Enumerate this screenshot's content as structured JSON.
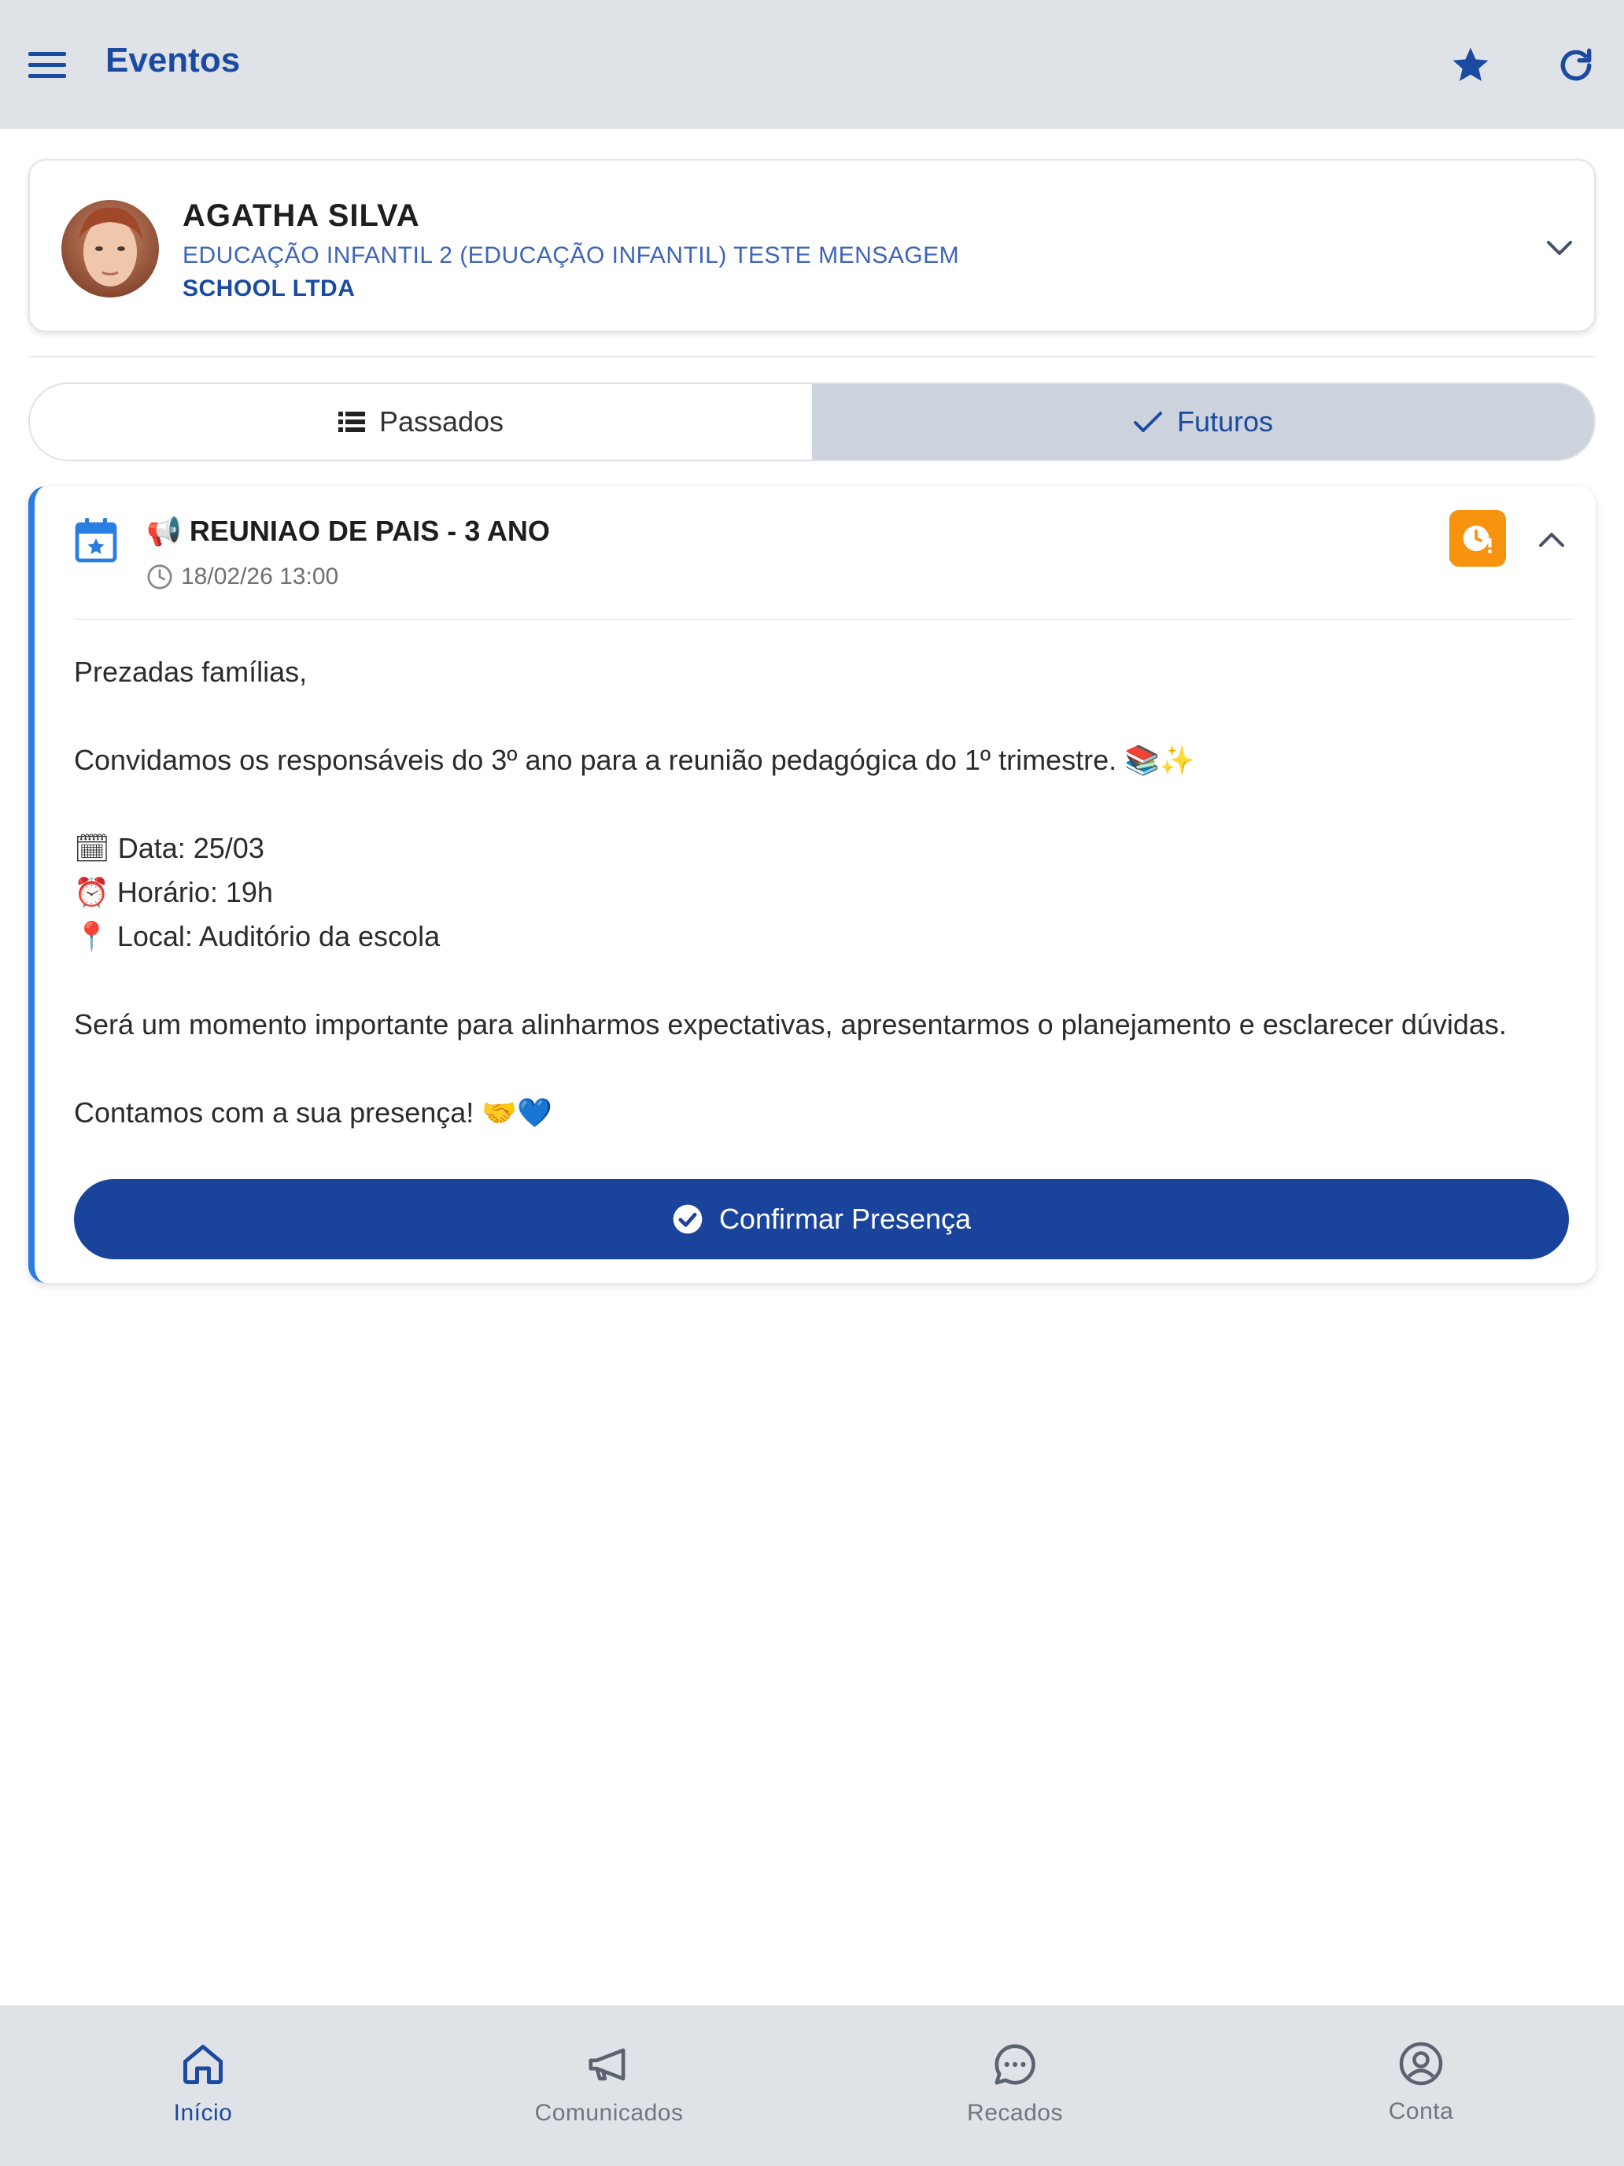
{
  "appbar": {
    "title": "Eventos",
    "menu_icon": "menu-icon",
    "favorite_icon": "star-icon",
    "refresh_icon": "refresh-icon"
  },
  "student": {
    "name": "AGATHA SILVA",
    "class": "EDUCAÇÃO INFANTIL 2 (EDUCAÇÃO INFANTIL) TESTE MENSAGEM",
    "school": "SCHOOL LTDA"
  },
  "tabs": [
    {
      "label": "Passados",
      "icon": "list-icon",
      "active": false
    },
    {
      "label": "Futuros",
      "icon": "check-icon",
      "active": true
    }
  ],
  "event": {
    "title": "📢 REUNIAO DE PAIS - 3 ANO",
    "datetime": "18/02/26 13:00",
    "body": {
      "greeting": "Prezadas famílias,",
      "invite": "Convidamos os responsáveis do 3º ano para a reunião pedagógica do 1º trimestre. 📚✨",
      "date_line": "🗓 Data: 25/03",
      "time_line": "⏰ Horário: 19h",
      "place_line": "📍 Local: Auditório da escola",
      "purpose": "Será um momento importante para alinharmos expectativas, apresentarmos o planejamento e esclarecer dúvidas.",
      "closing": "Contamos com a sua presença! 🤝💙"
    },
    "confirm_label": "Confirmar Presença"
  },
  "bottom_nav": [
    {
      "label": "Início",
      "icon": "home-icon",
      "active": true
    },
    {
      "label": "Comunicados",
      "icon": "megaphone-icon",
      "active": false
    },
    {
      "label": "Recados",
      "icon": "chat-icon",
      "active": false
    },
    {
      "label": "Conta",
      "icon": "account-icon",
      "active": false
    }
  ],
  "colors": {
    "primary": "#1b4aa1",
    "appbar_bg": "#dfe3e8",
    "accent_border": "#2a7de1",
    "badge": "#f7930e",
    "button": "#1a449c"
  }
}
